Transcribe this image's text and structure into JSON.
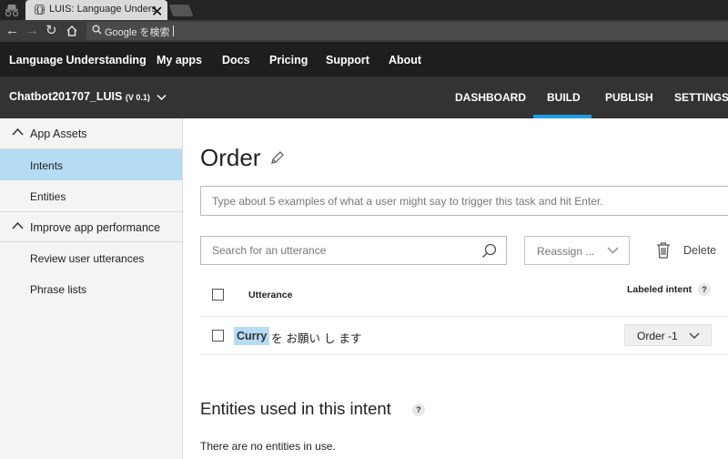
{
  "browser": {
    "tab_title": "LUIS: Language Understa",
    "favicon_text": "{}",
    "omnibox_text": "Google を検索"
  },
  "topnav": {
    "items": [
      "Language Understanding",
      "My apps",
      "Docs",
      "Pricing",
      "Support",
      "About"
    ]
  },
  "appbar": {
    "app_name": "Chatbot201707_LUIS",
    "version": "(V 0.1)",
    "tabs": [
      "DASHBOARD",
      "BUILD",
      "PUBLISH",
      "SETTINGS"
    ],
    "active_tab": "BUILD",
    "accent_color": "#1ba1e2"
  },
  "sidebar": {
    "sections": [
      {
        "label": "App Assets",
        "items": [
          "Intents",
          "Entities"
        ]
      },
      {
        "label": "Improve app performance",
        "items": [
          "Review user utterances",
          "Phrase lists"
        ]
      }
    ],
    "active_item": "Intents",
    "active_color": "#b6dcf4"
  },
  "main": {
    "title": "Order",
    "example_placeholder": "Type about 5 examples of what a user might say to trigger this task and hit Enter.",
    "search_placeholder": "Search for an utterance",
    "reassign_label": "Reassign ...",
    "delete_label": "Delete",
    "columns": {
      "utterance": "Utterance",
      "labeled_intent": "Labeled intent"
    },
    "help_glyph": "?",
    "utterances": [
      {
        "entity": "Curry",
        "rest": "を お願い し ます",
        "intent": "Order -1"
      }
    ],
    "entities_heading": "Entities used in this intent",
    "no_entities_text": "There are no entities in use."
  }
}
